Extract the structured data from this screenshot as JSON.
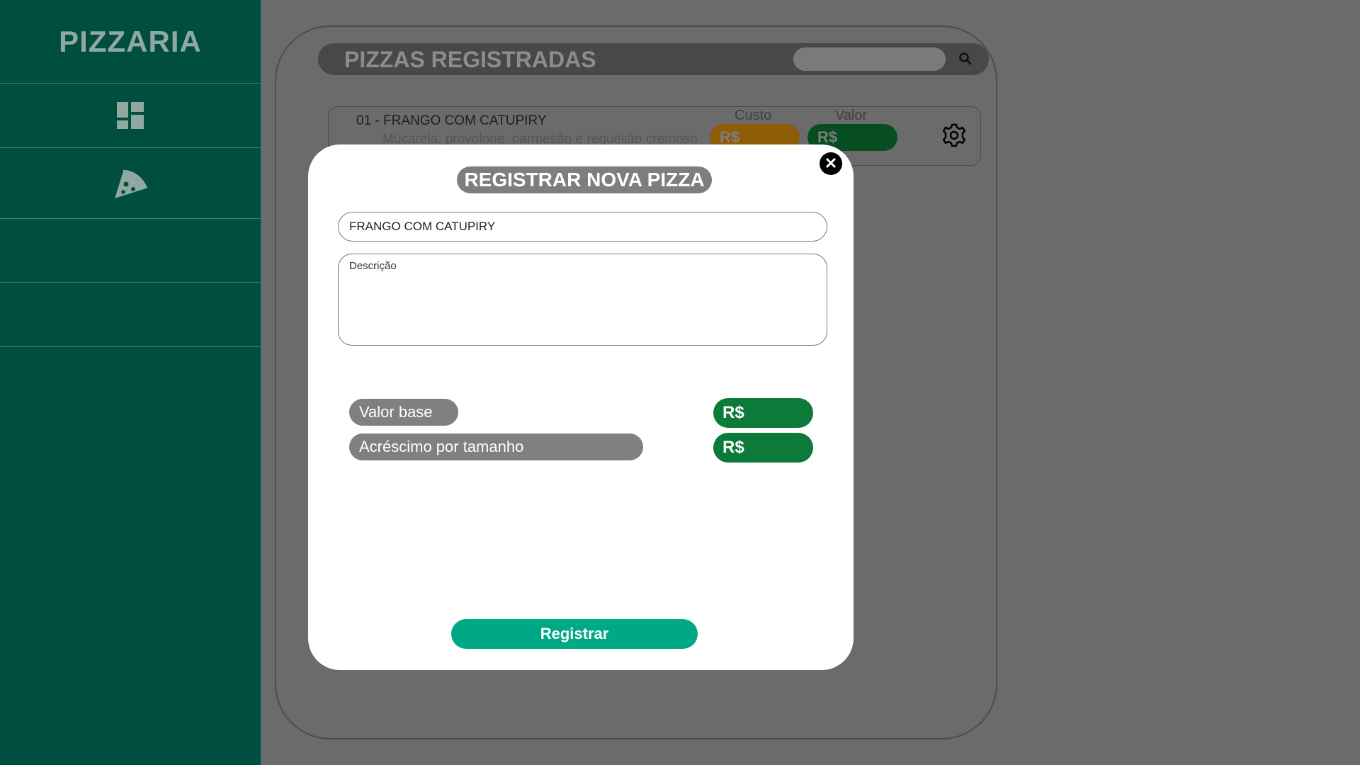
{
  "sidebar": {
    "brand": "PIZZARIA",
    "items": [
      {
        "icon": "dashboard-icon"
      },
      {
        "icon": "pizza-slice-icon"
      },
      {
        "icon": ""
      },
      {
        "icon": ""
      }
    ]
  },
  "header": {
    "title": "PIZZAS REGISTRADAS",
    "search_placeholder": "",
    "search_icon": "search-icon"
  },
  "pizza_list": [
    {
      "title": "01 - FRANGO COM CATUPIRY",
      "description": "Mucarela, provolone, parmesão e requeijão cremoso",
      "cost_label": "Custo",
      "cost_value": "R$",
      "price_label": "Valor",
      "price_value": "R$",
      "settings_icon": "gear-icon"
    }
  ],
  "modal": {
    "title": "REGISTRAR NOVA PIZZA",
    "close_label": "✕",
    "name_value": "FRANGO COM CATUPIRY",
    "description_placeholder": "Descrição",
    "base_label": "Valor base",
    "base_value": "R$",
    "increment_label": "Acréscimo por tamanho",
    "increment_value": "R$",
    "submit_label": "Registrar"
  },
  "colors": {
    "sidebar": "#004e40",
    "overlay": "#6b6b6b",
    "money": "#0c7a39",
    "cost": "#8f5c06",
    "submit": "#00a985"
  }
}
